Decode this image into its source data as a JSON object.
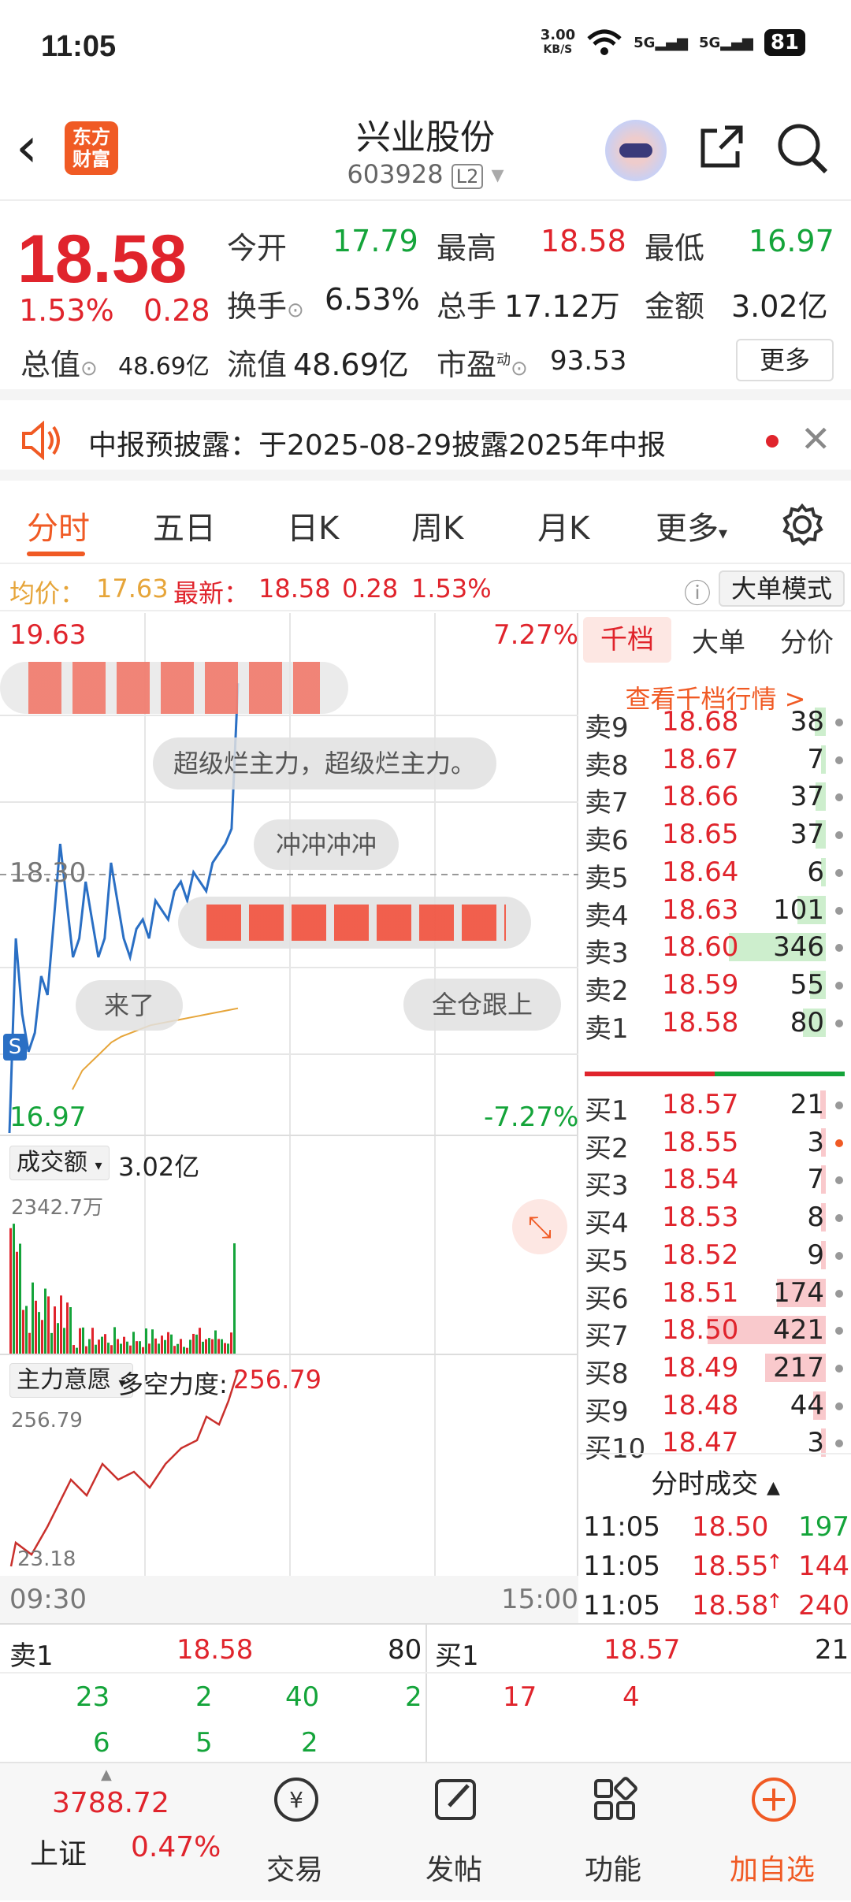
{
  "status_bar": {
    "time": "11:05",
    "net_speed_value": "3.00",
    "net_speed_unit": "KB/S",
    "signal1": "5G",
    "signal2": "5G",
    "battery": "81"
  },
  "header": {
    "title": "兴业股份",
    "code": "603928",
    "level": "L2",
    "logo_line1": "东方",
    "logo_line2": "财富"
  },
  "quote": {
    "price": "18.58",
    "change_pct": "1.53%",
    "change": "0.28",
    "open_label": "今开",
    "open": "17.79",
    "high_label": "最高",
    "high": "18.58",
    "low_label": "最低",
    "low": "16.97",
    "turnover_label": "换手",
    "turnover": "6.53%",
    "volume_label": "总手",
    "volume": "17.12万",
    "amount_label": "金额",
    "amount": "3.02亿",
    "total_cap_label": "总值",
    "total_cap": "48.69亿",
    "float_cap_label": "流值",
    "float_cap": "48.69亿",
    "pe_label": "市盈",
    "pe_sup": "动",
    "pe": "93.53",
    "more": "更多"
  },
  "notice": {
    "text": "中报预披露：于2025-08-29披露2025年中报"
  },
  "tabs": [
    {
      "label": "分时"
    },
    {
      "label": "五日"
    },
    {
      "label": "日K"
    },
    {
      "label": "周K"
    },
    {
      "label": "月K"
    },
    {
      "label": "更多"
    }
  ],
  "avg_line": {
    "avg_label": "均价：",
    "avg": "17.63",
    "latest_label": "最新：",
    "latest": "18.58",
    "chg": "0.28",
    "pct": "1.53%",
    "big_mode": "大单模式"
  },
  "chart": {
    "top_price": "19.63",
    "top_pct": "7.27%",
    "ref_price": "18.30",
    "bottom_price": "16.97",
    "bottom_pct": "-7.27%",
    "s_marker": "S",
    "bubbles": [
      "超级烂主力，超级烂主力。",
      "冲冲冲冲",
      "来了",
      "全仓跟上"
    ],
    "vol_label": "成交额",
    "vol_value": "3.02亿",
    "vol_max": "2342.7万",
    "ind_label": "主力意愿",
    "ind_desc": "多空力度:",
    "ind_value": "256.79",
    "ind_top": "256.79",
    "ind_bottom": "23.18",
    "time_start": "09:30",
    "time_end": "15:00"
  },
  "chart_data": {
    "type": "line",
    "series": [
      {
        "values": [
          16.97,
          18.0,
          17.6,
          17.4,
          17.5,
          17.8,
          17.7,
          18.1,
          18.5,
          18.2,
          17.9,
          18.0,
          18.3,
          18.1,
          17.9,
          18.0,
          18.4,
          18.2,
          18.0,
          17.9,
          18.05,
          18.1,
          18.0,
          18.2,
          18.15,
          18.1,
          18.25,
          18.3,
          18.2,
          18.35,
          18.3,
          18.25,
          18.4,
          18.45,
          18.5,
          18.58,
          19.35
        ]
      },
      {
        "values": [
          17.2,
          17.3,
          17.35,
          17.4,
          17.45,
          17.48,
          17.5,
          17.52,
          17.54,
          17.55,
          17.56,
          17.57,
          17.58,
          17.59,
          17.6,
          17.61,
          17.62,
          17.63
        ]
      }
    ],
    "ylim": [
      16.97,
      19.63
    ]
  },
  "orderbook": {
    "tabs": [
      "千档",
      "大单",
      "分价"
    ],
    "link": "查看千档行情 >",
    "asks": [
      {
        "label": "卖9",
        "price": "18.68",
        "vol": "38"
      },
      {
        "label": "卖8",
        "price": "18.67",
        "vol": "7"
      },
      {
        "label": "卖7",
        "price": "18.66",
        "vol": "37"
      },
      {
        "label": "卖6",
        "price": "18.65",
        "vol": "37"
      },
      {
        "label": "卖5",
        "price": "18.64",
        "vol": "6"
      },
      {
        "label": "卖4",
        "price": "18.63",
        "vol": "101"
      },
      {
        "label": "卖3",
        "price": "18.60",
        "vol": "346"
      },
      {
        "label": "卖2",
        "price": "18.59",
        "vol": "55"
      },
      {
        "label": "卖1",
        "price": "18.58",
        "vol": "80"
      }
    ],
    "bids": [
      {
        "label": "买1",
        "price": "18.57",
        "vol": "21"
      },
      {
        "label": "买2",
        "price": "18.55",
        "vol": "3"
      },
      {
        "label": "买3",
        "price": "18.54",
        "vol": "7"
      },
      {
        "label": "买4",
        "price": "18.53",
        "vol": "8"
      },
      {
        "label": "买5",
        "price": "18.52",
        "vol": "9"
      },
      {
        "label": "买6",
        "price": "18.51",
        "vol": "174"
      },
      {
        "label": "买7",
        "price": "18.50",
        "vol": "421"
      },
      {
        "label": "买8",
        "price": "18.49",
        "vol": "217"
      },
      {
        "label": "买9",
        "price": "18.48",
        "vol": "44"
      },
      {
        "label": "买10",
        "price": "18.47",
        "vol": "3"
      }
    ],
    "trades_title": "分时成交",
    "trades": [
      {
        "time": "11:05",
        "price": "18.50",
        "arrow": "",
        "vol": "197"
      },
      {
        "time": "11:05",
        "price": "18.55",
        "arrow": "↑",
        "vol": "144"
      },
      {
        "time": "11:05",
        "price": "18.58",
        "arrow": "↑",
        "vol": "240"
      }
    ]
  },
  "bottom_quote": {
    "sell_label": "卖1",
    "sell_price": "18.58",
    "sell_vol": "80",
    "buy_label": "买1",
    "buy_price": "18.57",
    "buy_vol": "21",
    "sell_q1": [
      "23",
      "2",
      "40",
      "2"
    ],
    "sell_q2": [
      "6",
      "5",
      "2"
    ],
    "buy_q1": [
      "17",
      "4"
    ]
  },
  "navbar": {
    "index_value": "3788.72",
    "index_name": "上证",
    "index_pct": "0.47%",
    "trade": "交易",
    "post": "发帖",
    "function": "功能",
    "add": "加自选"
  },
  "colors": {
    "up": "#e0242c",
    "down": "#14a43a",
    "accent": "#f05a24",
    "line": "#2a6fc4",
    "avg": "#e6a53a"
  }
}
